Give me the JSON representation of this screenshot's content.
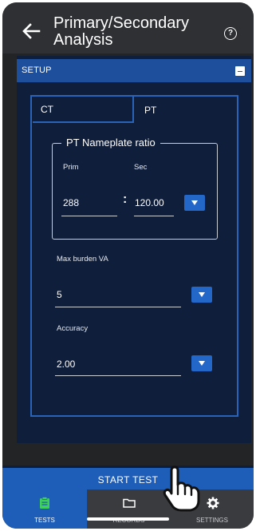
{
  "header": {
    "title": "Primary/Secondary Analysis",
    "help_icon": "?"
  },
  "setup": {
    "label": "SETUP"
  },
  "tabs": [
    {
      "label": "CT",
      "active": false
    },
    {
      "label": "PT",
      "active": true
    }
  ],
  "nameplate": {
    "legend": "PT Nameplate ratio",
    "prim_label": "Prim",
    "sec_label": "Sec",
    "prim_value": "288",
    "separator": ":",
    "sec_value": "120.00"
  },
  "max_burden": {
    "label": "Max burden VA",
    "value": "5"
  },
  "accuracy": {
    "label": "Accuracy",
    "value": "2.00"
  },
  "start_button": {
    "label": "START TEST"
  },
  "bottom_nav": [
    {
      "label": "TESTS",
      "icon": "clipboard-icon",
      "active": true
    },
    {
      "label": "RECORDS",
      "icon": "folder-icon",
      "active": false
    },
    {
      "label": "SETTINGS",
      "icon": "gear-icon",
      "active": false
    }
  ],
  "colors": {
    "accent": "#1f5eb8",
    "panel_border": "#2a64b8",
    "content_bg": "#0f1e3b"
  }
}
